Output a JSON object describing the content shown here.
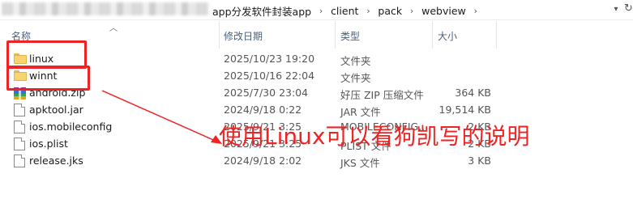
{
  "address_bar": {
    "crumbs": [
      "app分发软件封装app",
      "client",
      "pack",
      "webview"
    ],
    "separator": "›"
  },
  "columns": {
    "name": "名称",
    "date": "修改日期",
    "type": "类型",
    "size": "大小"
  },
  "files": [
    {
      "name": "linux",
      "date": "2025/10/23 19:20",
      "type": "文件夹",
      "size": "",
      "icon": "folder-icon"
    },
    {
      "name": "winnt",
      "date": "2025/10/16 22:04",
      "type": "文件夹",
      "size": "",
      "icon": "folder-icon"
    },
    {
      "name": "android.zip",
      "date": "2025/7/30 23:04",
      "type": "好压 ZIP 压缩文件",
      "size": "364 KB",
      "icon": "zip-archive-icon"
    },
    {
      "name": "apktool.jar",
      "date": "2024/9/18 0:22",
      "type": "JAR 文件",
      "size": "19,514 KB",
      "icon": "file-icon"
    },
    {
      "name": "ios.mobileconfig",
      "date": "2025/9/21 3:25",
      "type": "MOBILECONFIG...",
      "size": "2 KB",
      "icon": "file-icon"
    },
    {
      "name": "ios.plist",
      "date": "2025/9/21 3:25",
      "type": "PLIST 文件",
      "size": "2 KB",
      "icon": "file-icon"
    },
    {
      "name": "release.jks",
      "date": "2024/9/18 2:02",
      "type": "JKS 文件",
      "size": "3 KB",
      "icon": "file-icon"
    }
  ],
  "annotation": {
    "text": "使用Linux可以看狗凯写的说明",
    "color": "#ee2323"
  }
}
